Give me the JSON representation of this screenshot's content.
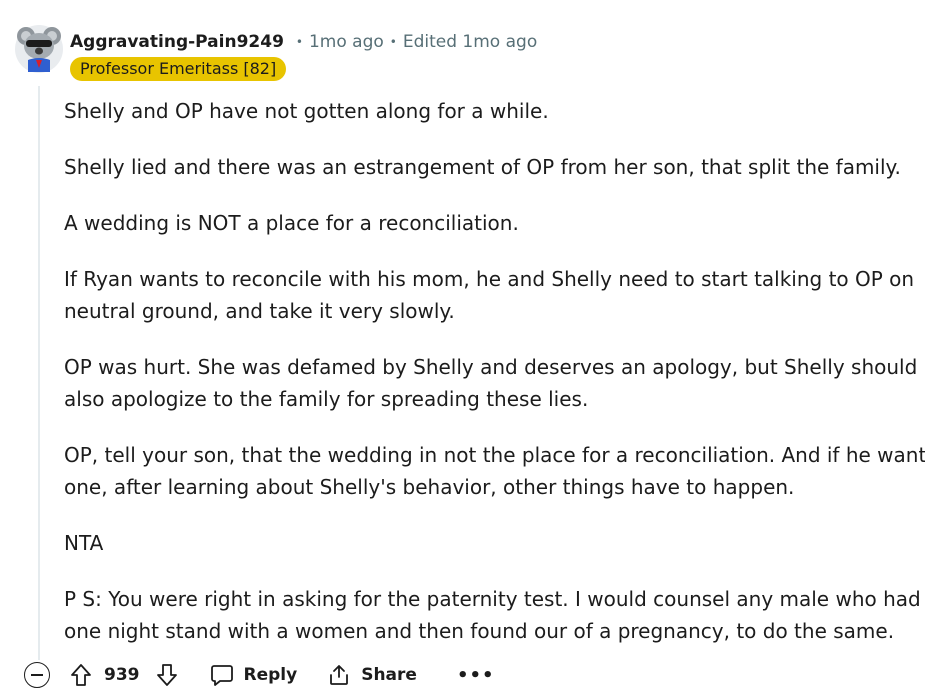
{
  "comment": {
    "username": "Aggravating-Pain9249",
    "posted": "1mo ago",
    "edited": "Edited 1mo ago",
    "flair": "Professor Emeritass [82]",
    "paragraphs": [
      "Shelly and OP have not gotten along for a while.",
      "Shelly lied and there was an estrangement of OP from her son, that split the family.",
      "A wedding is NOT a place for a reconciliation.",
      "If Ryan wants to reconcile with his mom, he and Shelly need to start talking to OP on",
      "neutral ground, and take it very slowly.",
      "OP was hurt. She was defamed by Shelly and deserves an apology, but Shelly should",
      "also apologize to the family for spreading these lies.",
      "OP, tell your son, that the wedding in not the place for a reconciliation. And if he wants",
      "one, after learning about Shelly's behavior, other things have to happen.",
      "NTA",
      "P S: You were right in asking for the paternity test. I would counsel any male who had a",
      "one night stand with a women and then found our of a pregnancy, to do the same."
    ]
  },
  "actions": {
    "score": "939",
    "reply_label": "Reply",
    "share_label": "Share",
    "more_label": "•••"
  },
  "icons": {
    "avatar": "koala-avatar-icon",
    "collapse": "minus-circle-icon",
    "upvote": "arrow-up-icon",
    "downvote": "arrow-down-icon",
    "reply": "speech-bubble-icon",
    "share": "share-icon",
    "more": "ellipsis-icon"
  },
  "colors": {
    "flair_bg": "#e8c400",
    "meta_text": "#576f76",
    "thread_line": "#e5ebee"
  }
}
